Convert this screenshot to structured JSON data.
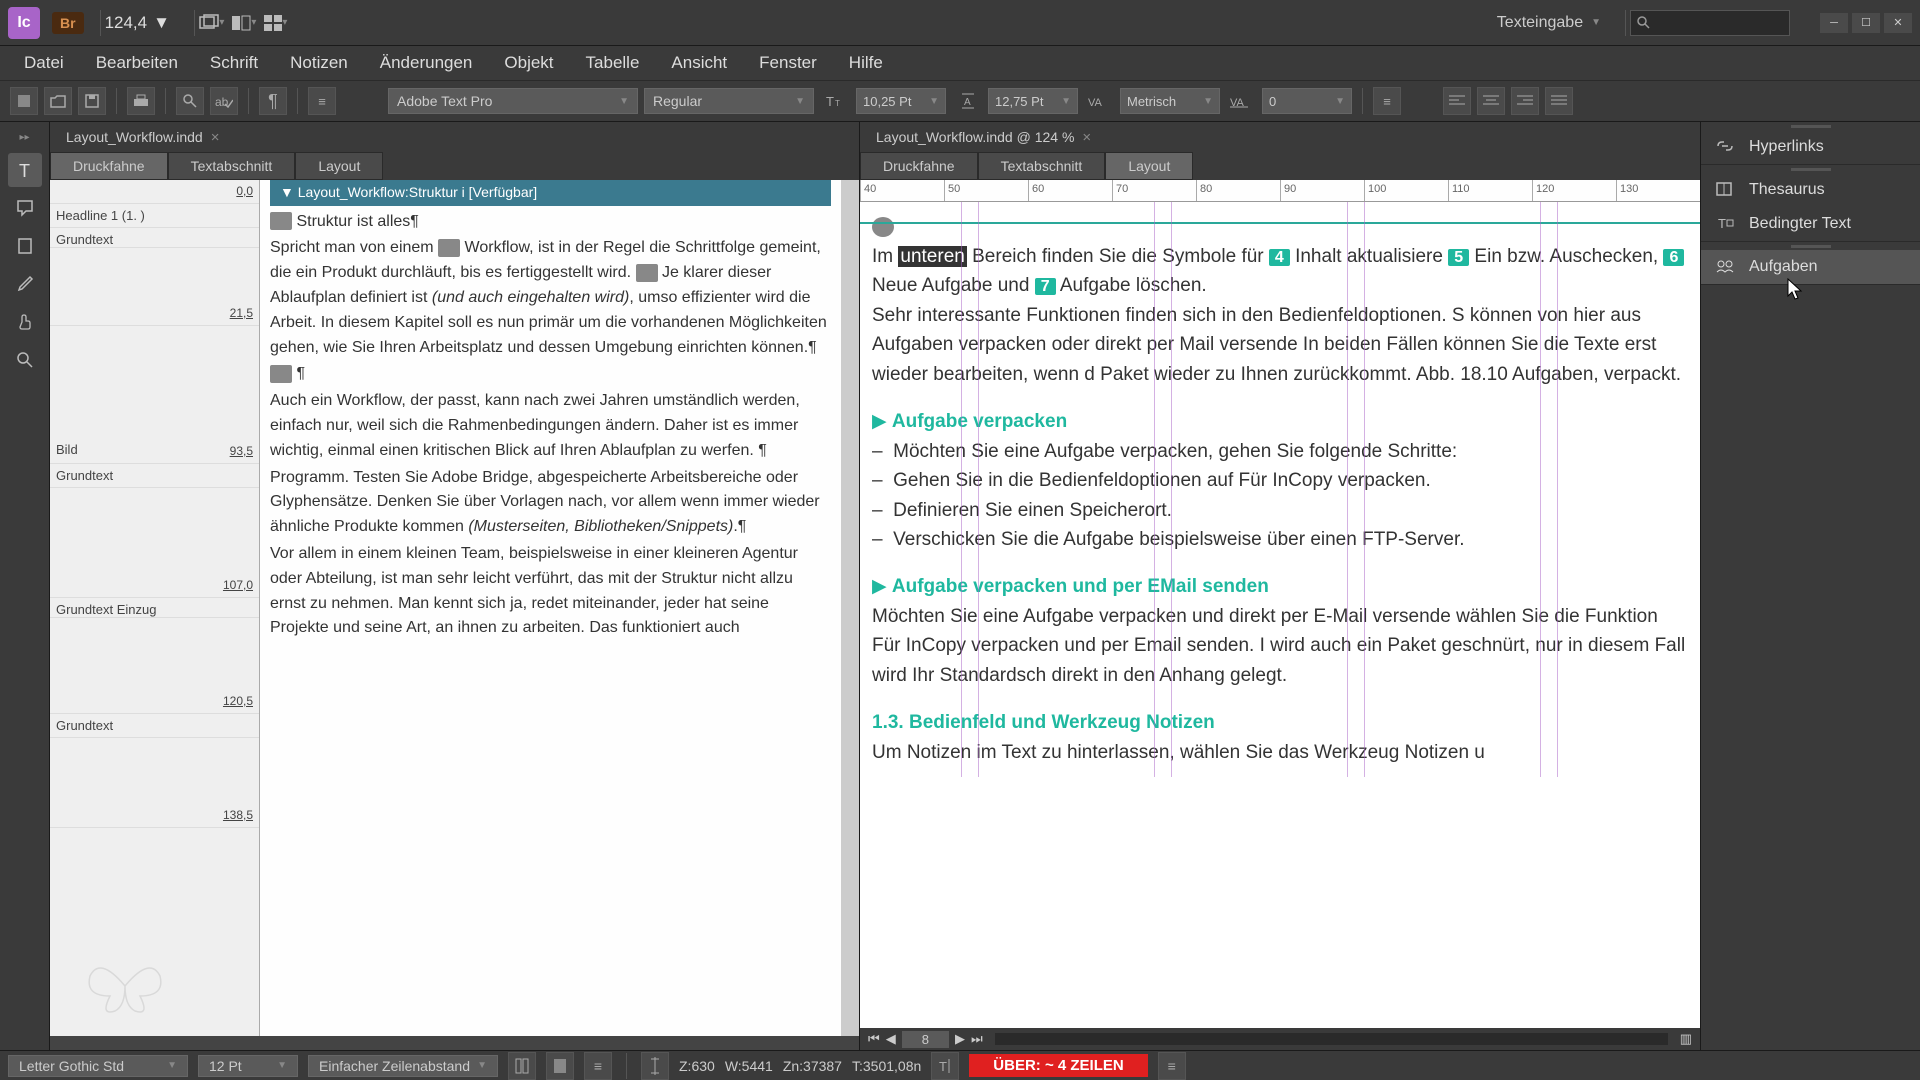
{
  "topbar": {
    "app_abbrev": "Ic",
    "bridge_badge": "Br",
    "zoom_value": "124,4",
    "workspace_label": "Texteingabe",
    "search_placeholder": ""
  },
  "menu": [
    "Datei",
    "Bearbeiten",
    "Schrift",
    "Notizen",
    "Änderungen",
    "Objekt",
    "Tabelle",
    "Ansicht",
    "Fenster",
    "Hilfe"
  ],
  "control": {
    "font_family": "Adobe Text Pro",
    "font_style": "Regular",
    "font_size": "10,25 Pt",
    "leading": "12,75 Pt",
    "kerning": "Metrisch",
    "tracking": "0"
  },
  "doc": {
    "tab1": "Layout_Workflow.indd",
    "tab2": "Layout_Workflow.indd @ 124 %"
  },
  "viewtabs": [
    "Druckfahne",
    "Textabschnitt",
    "Layout"
  ],
  "galley": {
    "story_title": "Layout_Workflow:Struktur i [Verfügbar]",
    "styles": [
      {
        "name": "",
        "depth": "0,0"
      },
      {
        "name": "Headline 1 (1. )",
        "depth": ""
      },
      {
        "name": "Grundtext",
        "depth": ""
      },
      {
        "name": "",
        "depth": "21,5"
      },
      {
        "name": "Bild",
        "depth": "93,5"
      },
      {
        "name": "Grundtext",
        "depth": ""
      },
      {
        "name": "",
        "depth": "107,0"
      },
      {
        "name": "Grundtext Einzug",
        "depth": ""
      },
      {
        "name": "",
        "depth": "120,5"
      },
      {
        "name": "Grundtext",
        "depth": ""
      },
      {
        "name": "",
        "depth": "138,5"
      }
    ],
    "line1": "Struktur ist alles¶",
    "line2": "Spricht man von einem ",
    "line2b": " Workflow, ist in der Regel die Schrittfolge gemeint, die ein Produkt durchläuft, bis es fertiggestellt wird. ",
    "line2c": " Je klarer dieser Ablaufplan definiert ist ",
    "line2d": "(und auch eingehalten wird)",
    "line2e": ", umso effizienter wird die Arbeit. In diesem Kapitel soll es nun primär um die vorhandenen Möglichkeiten gehen, wie Sie Ihren Arbeitsplatz und dessen Umgebung einrichten können.¶",
    "line3": " ¶",
    "line4": "Auch ein Workflow, der passt, kann nach zwei Jahren umständlich werden, einfach nur, weil sich die Rahmenbedingungen ändern. Daher ist es immer wichtig, einmal einen kritischen Blick auf Ihren Ablaufplan zu werfen. ¶",
    "line5a": "Programm. Testen Sie Adobe Bridge, abgespeicherte Arbeitsbereiche oder Glyphensätze. Denken Sie über Vorlagen nach, vor allem wenn immer wieder ähnliche Produkte kommen ",
    "line5b": "(Musterseiten, Bibliotheken/Snippets)",
    "line5c": ".¶",
    "line6": "Vor allem in einem kleinen Team, beispielsweise in einer kleineren Agentur oder Abteilung, ist man sehr leicht verführt, das mit der Struktur nicht allzu ernst zu nehmen. Man kennt sich ja, redet miteinander, jeder hat seine Projekte und seine Art, an ihnen zu arbeiten. Das funktioniert auch"
  },
  "ruler_ticks": [
    "40",
    "50",
    "60",
    "70",
    "80",
    "90",
    "100",
    "110",
    "120",
    "130"
  ],
  "layout": {
    "p1a": "Im ",
    "p1_hilite": "unteren",
    "p1b": " Bereich finden Sie die Symbole für ",
    "p1c": " Inhalt aktualisiere ",
    "p1d": " Ein bzw. Auschecken, ",
    "p1e": " Neue Aufgabe und ",
    "p1f": " Aufgabe löschen.",
    "badge4": "4",
    "badge5": "5",
    "badge6": "6",
    "badge7": "7",
    "p2": "Sehr interessante Funktionen finden sich in den Bedienfeldoptionen. S können von hier aus Aufgaben verpacken oder direkt per Mail versende In beiden Fällen können Sie die Texte erst wieder bearbeiten, wenn d Paket wieder zu Ihnen zurückkommt. Abb. 18.10 Aufgaben, verpackt.",
    "h1": "Aufgabe verpacken",
    "b1": "Möchten Sie eine Aufgabe verpacken, gehen Sie folgende Schritte:",
    "b2": "Gehen Sie in die Bedienfeldoptionen auf Für InCopy verpacken.",
    "b3": "Definieren Sie einen Speicherort.",
    "b4": "Verschicken Sie die Aufgabe beispielsweise über einen FTP-Server.",
    "h2": "Aufgabe verpacken und per EMail senden",
    "p3": "Möchten Sie eine Aufgabe verpacken und direkt per E-Mail versende wählen Sie die Funktion Für InCopy verpacken und per Email senden. I wird auch ein Paket geschnürt, nur in diesem Fall wird Ihr Standardsch direkt in den Anhang gelegt.",
    "h3": "1.3.  Bedienfeld und Werkzeug Notizen",
    "p4": "Um Notizen im Text zu hinterlassen, wählen Sie das Werkzeug Notizen u"
  },
  "pagenav": {
    "page": "8"
  },
  "right_panels": [
    "Hyperlinks",
    "Thesaurus",
    "Bedingter Text",
    "Aufgaben"
  ],
  "status": {
    "font": "Letter Gothic Std",
    "size": "12 Pt",
    "spacing": "Einfacher Zeilenabstand",
    "z": "Z:630",
    "w": "W:5441",
    "zn": "Zn:37387",
    "t": "T:3501,08n",
    "overset": "ÜBER:  ~ 4 ZEILEN"
  }
}
